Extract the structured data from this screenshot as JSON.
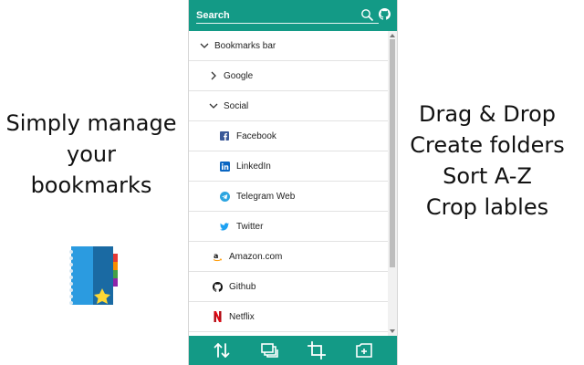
{
  "promo_left": {
    "lines": [
      "Simply manage",
      "your",
      "bookmarks"
    ]
  },
  "promo_right": {
    "lines": [
      "Drag & Drop",
      "Create folders",
      "Sort A-Z",
      "Crop lables"
    ]
  },
  "search": {
    "placeholder": "Search"
  },
  "theme": {
    "accent": "#139a86",
    "divider": "#e2e2e2"
  },
  "tree": [
    {
      "label": "Bookmarks bar",
      "kind": "folder",
      "state": "expanded",
      "icon": "chevron-down-icon"
    },
    {
      "label": "Google",
      "kind": "folder",
      "state": "collapsed",
      "icon": "chevron-right-icon"
    },
    {
      "label": "Social",
      "kind": "folder",
      "state": "expanded",
      "icon": "chevron-down-icon"
    },
    {
      "label": "Facebook",
      "kind": "link",
      "icon": "facebook-icon"
    },
    {
      "label": "LinkedIn",
      "kind": "link",
      "icon": "linkedin-icon"
    },
    {
      "label": "Telegram Web",
      "kind": "link",
      "icon": "telegram-icon"
    },
    {
      "label": "Twitter",
      "kind": "link",
      "icon": "twitter-icon"
    },
    {
      "label": "Amazon.com",
      "kind": "link",
      "icon": "amazon-icon"
    },
    {
      "label": "Github",
      "kind": "link",
      "icon": "github-icon"
    },
    {
      "label": "Netflix",
      "kind": "link",
      "icon": "netflix-icon"
    }
  ],
  "toolbar": {
    "buttons": [
      {
        "icon": "sort-icon"
      },
      {
        "icon": "folders-icon"
      },
      {
        "icon": "crop-icon"
      },
      {
        "icon": "add-folder-icon"
      }
    ]
  }
}
